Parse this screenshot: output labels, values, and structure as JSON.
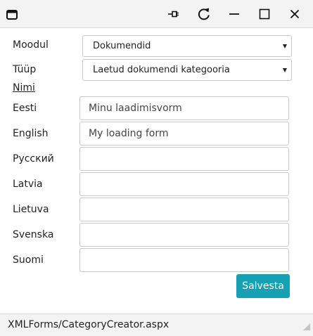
{
  "titlebar": {
    "icons": [
      "window-icon",
      "pin-icon",
      "refresh-icon",
      "minimize-icon",
      "maximize-icon",
      "close-icon"
    ]
  },
  "form": {
    "moodul": {
      "label": "Moodul",
      "value": "Dokumendid"
    },
    "tyyp": {
      "label": "Tüüp",
      "value": "Laetud dokumendi kategooria"
    },
    "nimi_heading": "Nimi",
    "fields": [
      {
        "label": "Eesti",
        "value": "Minu laadimisvorm"
      },
      {
        "label": "English",
        "value": "My loading form"
      },
      {
        "label": "Русский",
        "value": ""
      },
      {
        "label": "Latvia",
        "value": ""
      },
      {
        "label": "Lietuva",
        "value": ""
      },
      {
        "label": "Svenska",
        "value": ""
      },
      {
        "label": "Suomi",
        "value": ""
      }
    ],
    "save_label": "Salvesta"
  },
  "statusbar": {
    "path": "XMLForms/CategoryCreator.aspx"
  },
  "colors": {
    "accent": "#15a0b4",
    "titlebar_bg": "#f3f3f3"
  }
}
